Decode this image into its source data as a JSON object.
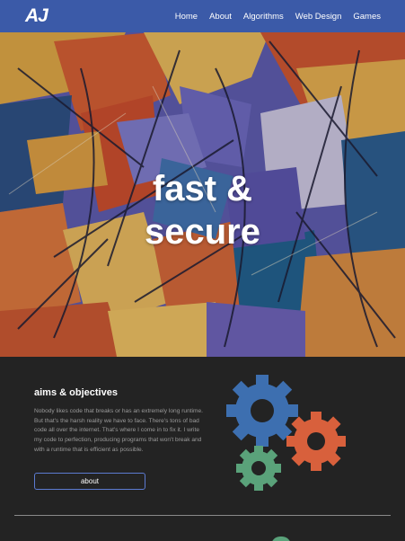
{
  "nav": {
    "logo_text": "AJ",
    "links": [
      "Home",
      "About",
      "Algorithms",
      "Web Design",
      "Games"
    ]
  },
  "hero": {
    "title_line1": "fast &",
    "title_line2": "secure"
  },
  "aims": {
    "heading": "aims & objectives",
    "body": "Nobody likes code that breaks or has an extremely long runtime. But that's the harsh reality we have to face. There's tons of bad code all over the internet. That's where I come in to fix it. I write my code to perfection, producing programs that won't break and with a runtime that is efficient as possible.",
    "button_label": "about"
  },
  "colors": {
    "nav_bg": "#3b5aa8",
    "section_bg": "#232323",
    "gear_blue": "#3d6fb0",
    "gear_orange": "#d8603c",
    "gear_green": "#5aa27a"
  },
  "icons": [
    "gears-icon"
  ]
}
